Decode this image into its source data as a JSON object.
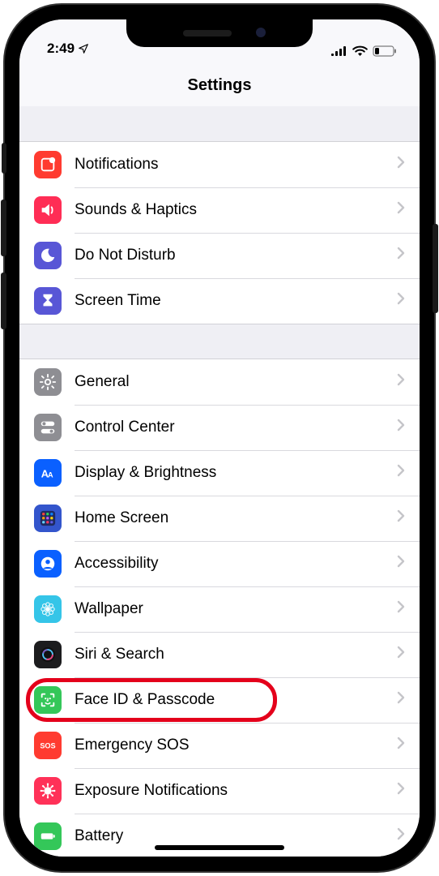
{
  "status": {
    "time": "2:49",
    "location_icon": "location-arrow",
    "signal": 4,
    "wifi": 3,
    "battery_pct": 20
  },
  "header": {
    "title": "Settings"
  },
  "groups": [
    {
      "rows": [
        {
          "id": "notifications",
          "label": "Notifications",
          "icon": "notifications-icon",
          "bg": "#ff3b30"
        },
        {
          "id": "sounds",
          "label": "Sounds & Haptics",
          "icon": "speaker-icon",
          "bg": "#ff2d55"
        },
        {
          "id": "dnd",
          "label": "Do Not Disturb",
          "icon": "moon-icon",
          "bg": "#5856d6"
        },
        {
          "id": "screentime",
          "label": "Screen Time",
          "icon": "hourglass-icon",
          "bg": "#5856d6"
        }
      ]
    },
    {
      "rows": [
        {
          "id": "general",
          "label": "General",
          "icon": "gear-icon",
          "bg": "#8e8e93"
        },
        {
          "id": "controlcenter",
          "label": "Control Center",
          "icon": "toggles-icon",
          "bg": "#8e8e93"
        },
        {
          "id": "display",
          "label": "Display & Brightness",
          "icon": "text-size-icon",
          "bg": "#0a60ff"
        },
        {
          "id": "homescreen",
          "label": "Home Screen",
          "icon": "grid-icon",
          "bg": "#3355cc"
        },
        {
          "id": "accessibility",
          "label": "Accessibility",
          "icon": "person-circle-icon",
          "bg": "#0a60ff"
        },
        {
          "id": "wallpaper",
          "label": "Wallpaper",
          "icon": "flower-icon",
          "bg": "#35c5e8"
        },
        {
          "id": "siri",
          "label": "Siri & Search",
          "icon": "siri-icon",
          "bg": "#1c1c1e"
        },
        {
          "id": "faceid",
          "label": "Face ID & Passcode",
          "icon": "faceid-icon",
          "bg": "#34c759",
          "highlighted": true
        },
        {
          "id": "sos",
          "label": "Emergency SOS",
          "icon": "sos-icon",
          "bg": "#ff3b30"
        },
        {
          "id": "exposure",
          "label": "Exposure Notifications",
          "icon": "virus-icon",
          "bg": "#ff3158"
        },
        {
          "id": "battery",
          "label": "Battery",
          "icon": "battery-icon",
          "bg": "#34c759"
        }
      ]
    }
  ]
}
